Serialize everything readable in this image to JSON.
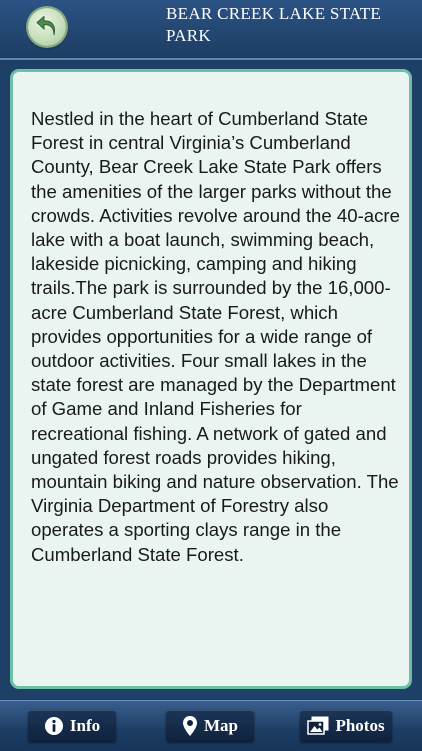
{
  "header": {
    "title": "BEAR CREEK LAKE STATE PARK",
    "back_icon": "back-arrow-icon"
  },
  "content": {
    "body": "Nestled in the heart of Cumberland State Forest in central Virginia’s Cumberland County, Bear Creek Lake State Park offers the amenities of the larger parks without the crowds. Activities revolve around the 40-acre lake with a boat launch, swimming beach, lakeside picnicking, camping and hiking trails.The park is surrounded by the 16,000-acre Cumberland State Forest, which provides opportunities for a wide range of outdoor activities. Four small lakes in the state forest are managed by the Department of Game and Inland Fisheries for recreational fishing. A network of gated and ungated forest roads provides hiking, mountain biking and nature observation. The Virginia Department of Forestry also operates a sporting clays range in the Cumberland State Forest."
  },
  "tabs": [
    {
      "label": "Info",
      "icon": "info-icon"
    },
    {
      "label": "Map",
      "icon": "map-pin-icon"
    },
    {
      "label": "Photos",
      "icon": "photos-icon"
    }
  ],
  "colors": {
    "header_bg": "#1f406a",
    "panel_bg": "#eaf5f1",
    "panel_border": "#6fbfa6",
    "tab_bg": "#0f223d",
    "back_button": "#c7dfbc"
  }
}
